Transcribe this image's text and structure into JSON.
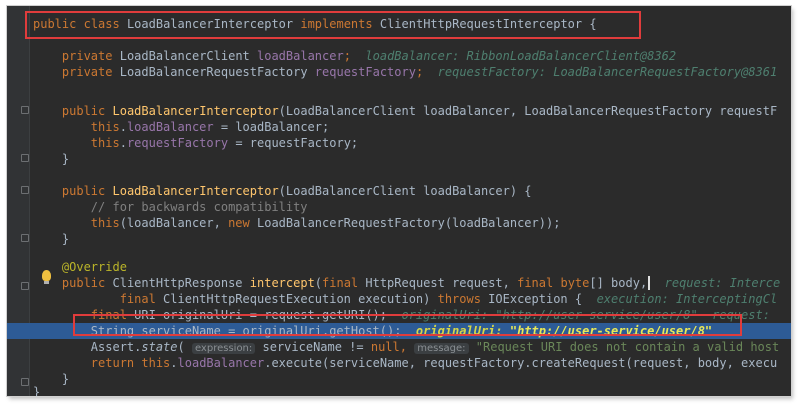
{
  "editor": {
    "title_line": {
      "kw1": "public",
      "kw2": "class",
      "name": "LoadBalancerInterceptor",
      "kw3": "implements",
      "iface": "ClientHttpRequestInterceptor",
      "brace": "{"
    },
    "field1": {
      "kw": "private",
      "type": "LoadBalancerClient",
      "name": "loadBalancer",
      "semi": ";",
      "hint": "loadBalancer: RibbonLoadBalancerClient@8362"
    },
    "field2": {
      "kw": "private",
      "type": "LoadBalancerRequestFactory",
      "name": "requestFactory",
      "semi": ";",
      "hint": "requestFactory: LoadBalancerRequestFactory@8361"
    },
    "ctor1": {
      "kw": "public",
      "name": "LoadBalancerInterceptor",
      "params": "(LoadBalancerClient loadBalancer, LoadBalancerRequestFactory requestF"
    },
    "ctor1_body1": {
      "kw": "this",
      "dot": ".",
      "fld": "loadBalancer",
      "rest": " = loadBalancer;"
    },
    "ctor1_body2": {
      "kw": "this",
      "dot": ".",
      "fld": "requestFactory",
      "rest": " = requestFactory;"
    },
    "close": "}",
    "ctor2": {
      "kw": "public",
      "name": "LoadBalancerInterceptor",
      "params": "(LoadBalancerClient loadBalancer) {"
    },
    "ctor2_comment": "// for backwards compatibility",
    "ctor2_body": {
      "kw1": "this",
      "mid": "(loadBalancer, ",
      "kw2": "new",
      "rest": " LoadBalancerRequestFactory(loadBalancer));"
    },
    "annotation": "@Override",
    "method_sig1": {
      "kw": "public",
      "type": " ClientHttpResponse ",
      "name": "intercept",
      "p1": "(",
      "kw2": "final",
      "p2": " HttpRequest request, ",
      "kw3": "final",
      "kw4": "byte",
      "p3": "[] body,",
      "hint": "request: Interce"
    },
    "method_sig2": {
      "kw": "final",
      "p": " ClientHttpRequestExecution execution) ",
      "kw2": "throws",
      "p2": " IOException {",
      "hint": "execution: InterceptingCl"
    },
    "line_uri": {
      "kw": "final",
      "p": " URI originalUri = request.getURI();",
      "hint": "originalUri: \"http://user-service/user/8\"  request:"
    },
    "line_service": {
      "p": "String serviceName = originalUri.getHost();",
      "hint_label": "originalUri:",
      "hint_value": "\"http://user-service/user/8\""
    },
    "line_assert": {
      "cls": "Assert.",
      "m": "state",
      "pill1": "expression:",
      "p": " serviceName != ",
      "kw": "null",
      "comma": ",",
      "pill2": "message:",
      "str": "\"Request URI does not contain a valid host"
    },
    "line_return": {
      "kw": "return",
      "kw2": " this",
      "dot": ".",
      "fld": "loadBalancer",
      "rest": ".execute(serviceName, requestFactory.createRequest(request, body, execu"
    },
    "colors": {
      "background": "#2b2b2b",
      "highlight": "#2d5b96",
      "keyword": "#cc7832",
      "field": "#9876aa",
      "method": "#ffc66d",
      "box": "#e03c3c"
    }
  }
}
